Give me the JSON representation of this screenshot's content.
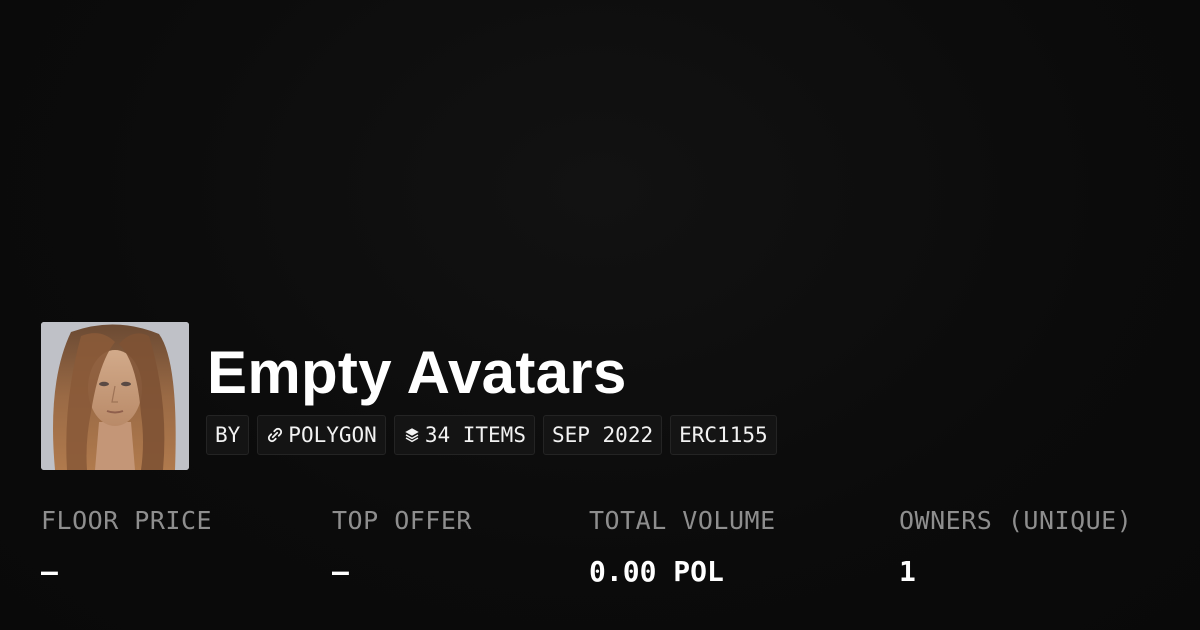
{
  "collection": {
    "name": "Empty Avatars",
    "avatar_icon": "collection-avatar-image"
  },
  "tags": [
    {
      "label": "BY",
      "icon": null
    },
    {
      "label": "POLYGON",
      "icon": "chain-link-icon"
    },
    {
      "label": "34 ITEMS",
      "icon": "layers-icon"
    },
    {
      "label": "SEP 2022",
      "icon": null
    },
    {
      "label": "ERC1155",
      "icon": null
    }
  ],
  "stats": [
    {
      "label": "FLOOR PRICE",
      "value": "–"
    },
    {
      "label": "TOP OFFER",
      "value": "–"
    },
    {
      "label": "TOTAL VOLUME",
      "value": "0.00 POL"
    },
    {
      "label": "OWNERS (UNIQUE)",
      "value": "1"
    }
  ],
  "colors": {
    "background": "#0c0c0c",
    "tag_background": "#141414",
    "label_gray": "#8e8e8e",
    "text": "#ffffff"
  }
}
